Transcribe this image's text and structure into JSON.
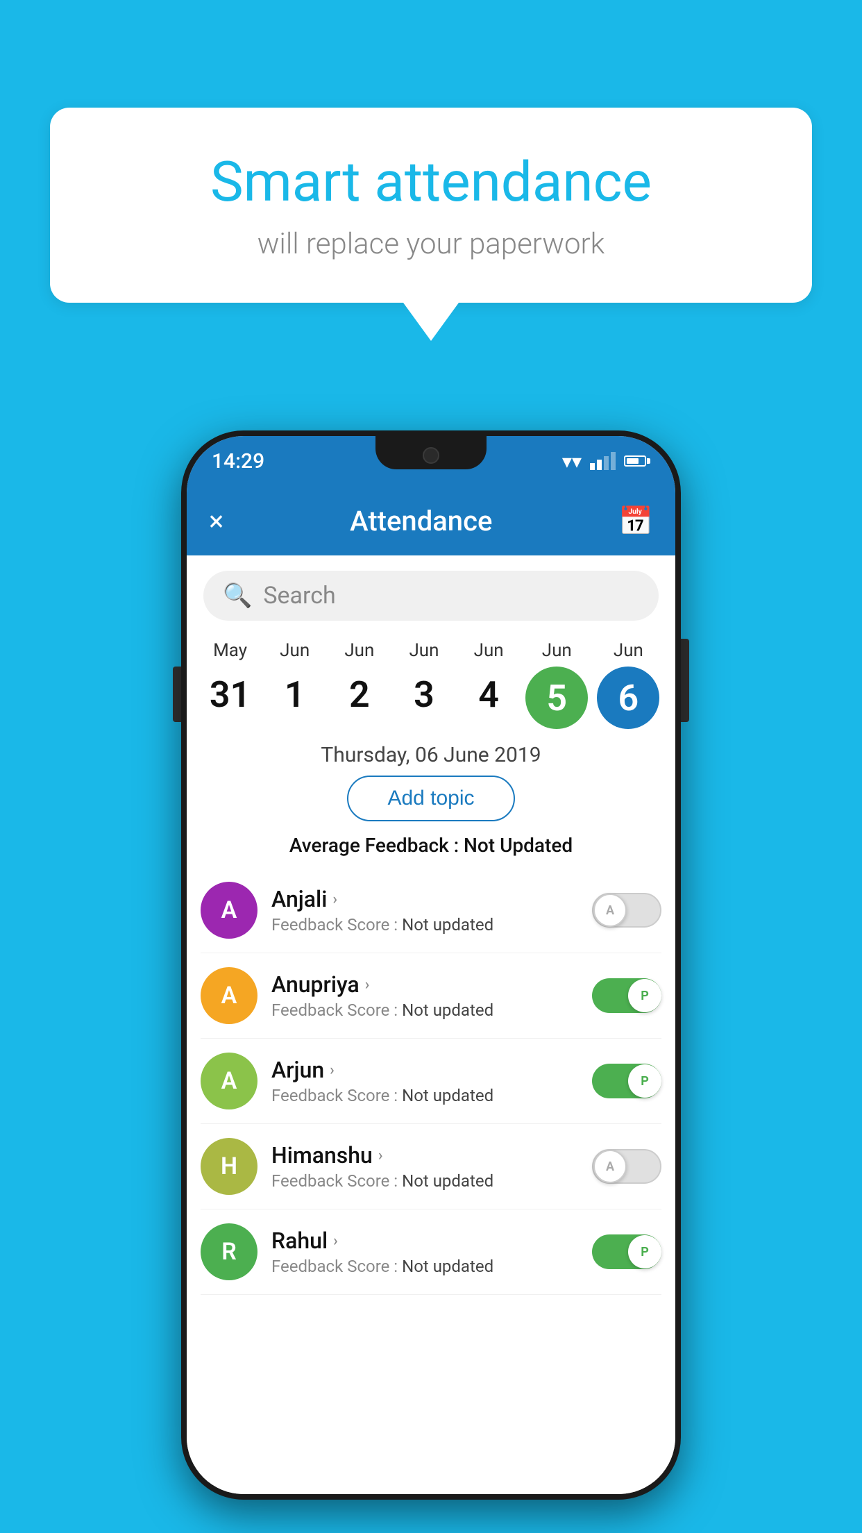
{
  "background_color": "#1ab8e8",
  "speech_bubble": {
    "title": "Smart attendance",
    "subtitle": "will replace your paperwork"
  },
  "status_bar": {
    "time": "14:29",
    "icons": [
      "wifi",
      "signal",
      "battery"
    ]
  },
  "app_bar": {
    "title": "Attendance",
    "close_label": "×",
    "calendar_label": "📅"
  },
  "search": {
    "placeholder": "Search"
  },
  "calendar": {
    "days": [
      {
        "month": "May",
        "date": "31",
        "style": "normal"
      },
      {
        "month": "Jun",
        "date": "1",
        "style": "normal"
      },
      {
        "month": "Jun",
        "date": "2",
        "style": "normal"
      },
      {
        "month": "Jun",
        "date": "3",
        "style": "normal"
      },
      {
        "month": "Jun",
        "date": "4",
        "style": "normal"
      },
      {
        "month": "Jun",
        "date": "5",
        "style": "today"
      },
      {
        "month": "Jun",
        "date": "6",
        "style": "selected"
      }
    ]
  },
  "selected_date": "Thursday, 06 June 2019",
  "add_topic_label": "Add topic",
  "average_feedback": {
    "label": "Average Feedback :",
    "value": "Not Updated"
  },
  "students": [
    {
      "name": "Anjali",
      "avatar_letter": "A",
      "avatar_color": "#9c27b0",
      "feedback_label": "Feedback Score :",
      "feedback_value": "Not updated",
      "toggle": "off",
      "toggle_letter": "A"
    },
    {
      "name": "Anupriya",
      "avatar_letter": "A",
      "avatar_color": "#f5a623",
      "feedback_label": "Feedback Score :",
      "feedback_value": "Not updated",
      "toggle": "on",
      "toggle_letter": "P"
    },
    {
      "name": "Arjun",
      "avatar_letter": "A",
      "avatar_color": "#8bc34a",
      "feedback_label": "Feedback Score :",
      "feedback_value": "Not updated",
      "toggle": "on",
      "toggle_letter": "P"
    },
    {
      "name": "Himanshu",
      "avatar_letter": "H",
      "avatar_color": "#aab844",
      "feedback_label": "Feedback Score :",
      "feedback_value": "Not updated",
      "toggle": "off",
      "toggle_letter": "A"
    },
    {
      "name": "Rahul",
      "avatar_letter": "R",
      "avatar_color": "#4caf50",
      "feedback_label": "Feedback Score :",
      "feedback_value": "Not updated",
      "toggle": "on",
      "toggle_letter": "P"
    }
  ]
}
